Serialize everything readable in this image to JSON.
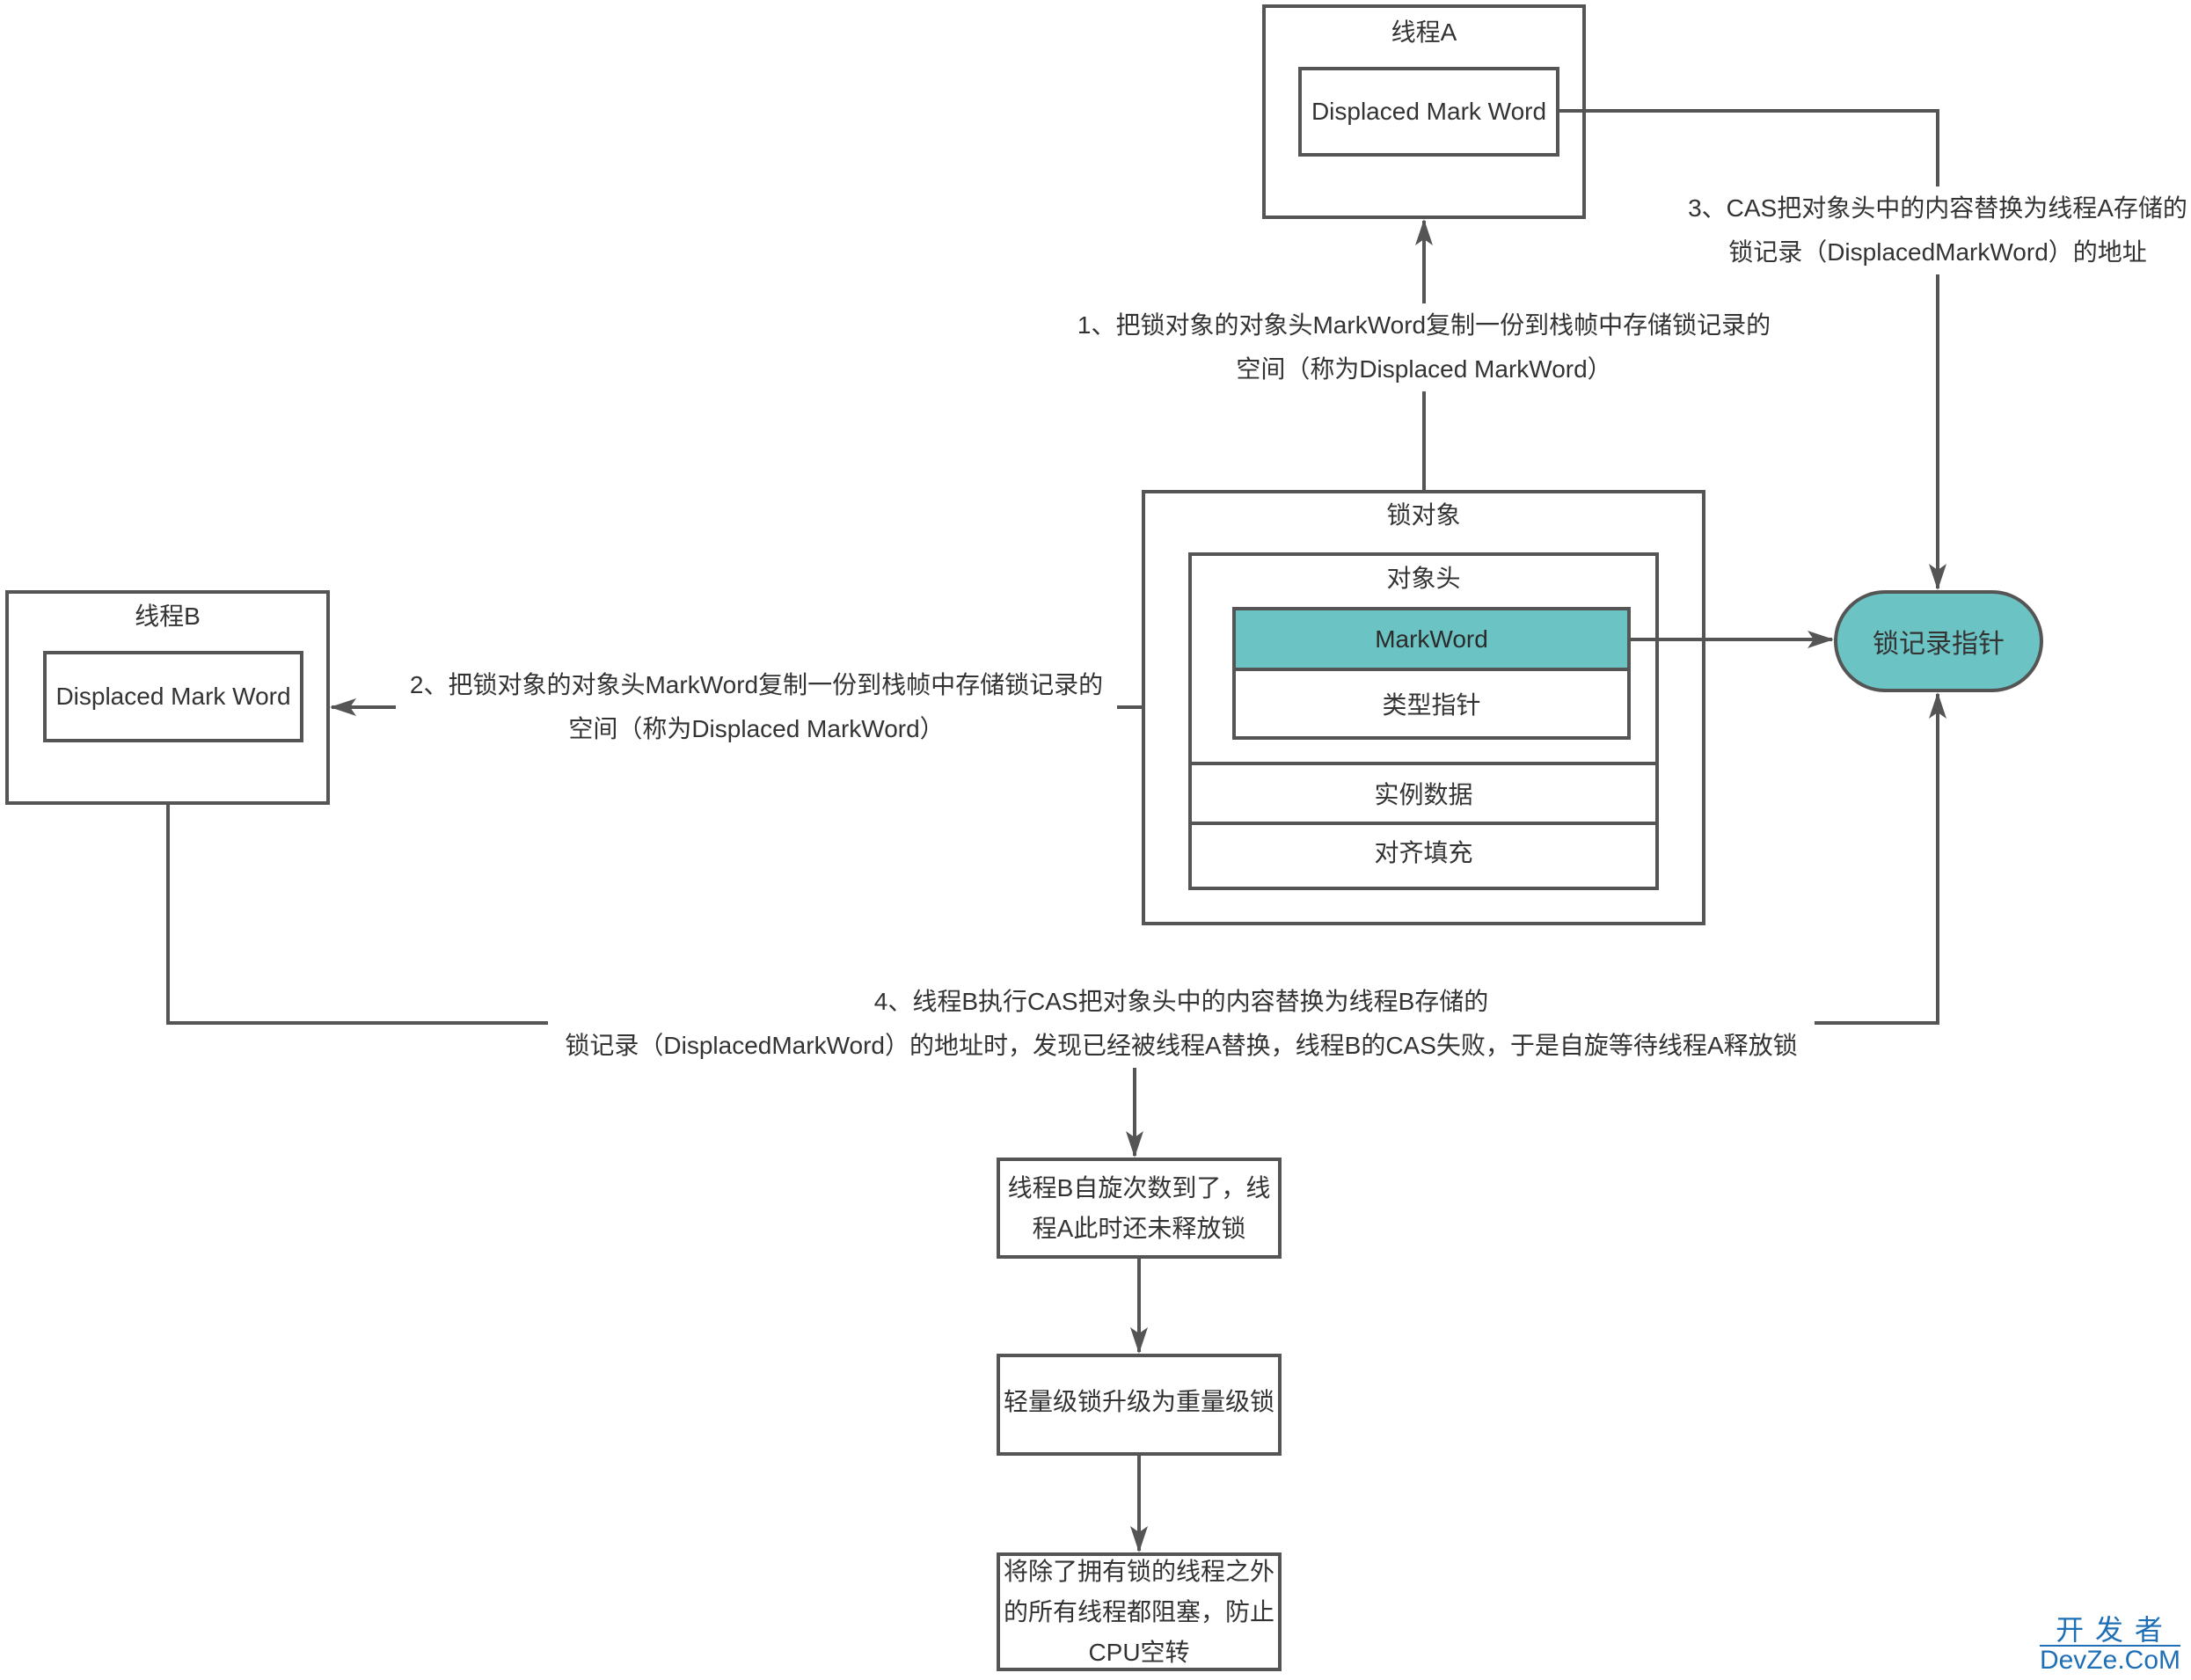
{
  "colors": {
    "accent": "#6cc3c4",
    "stroke": "#555555",
    "text": "#333333",
    "watermark": "#1f6fb6"
  },
  "thread_a": {
    "title": "线程A",
    "record": "Displaced Mark Word"
  },
  "thread_b": {
    "title": "线程B",
    "record": "Displaced Mark Word"
  },
  "lock_object": {
    "title": "锁对象",
    "header": {
      "title": "对象头",
      "mark_word": "MarkWord",
      "type_pointer": "类型指针"
    },
    "instance_data": "实例数据",
    "padding": "对齐填充"
  },
  "lock_record_pointer": "锁记录指针",
  "steps": [
    {
      "lines": [
        "1、把锁对象的对象头MarkWord复制一份到栈帧中存储锁记录的",
        "空间（称为Displaced MarkWord）"
      ]
    },
    {
      "lines": [
        "2、把锁对象的对象头MarkWord复制一份到栈帧中存储锁记录的",
        "空间（称为Displaced MarkWord）"
      ]
    },
    {
      "lines": [
        "3、CAS把对象头中的内容替换为线程A存储的",
        "锁记录（DisplacedMarkWord）的地址"
      ]
    },
    {
      "lines": [
        "4、线程B执行CAS把对象头中的内容替换为线程B存储的",
        "锁记录（DisplacedMarkWord）的地址时，发现已经被线程A替换，线程B的CAS失败，于是自旋等待线程A释放锁"
      ]
    }
  ],
  "flow": [
    {
      "lines": [
        "线程B自旋次数到了，线",
        "程A此时还未释放锁"
      ]
    },
    {
      "lines": [
        "轻量级锁升级为重量级锁"
      ]
    },
    {
      "lines": [
        "将除了拥有锁的线程之外",
        "的所有线程都阻塞，防止",
        "CPU空转"
      ]
    }
  ],
  "watermark": {
    "line1": "开 发 者",
    "line2": "DevZe.CoM"
  }
}
